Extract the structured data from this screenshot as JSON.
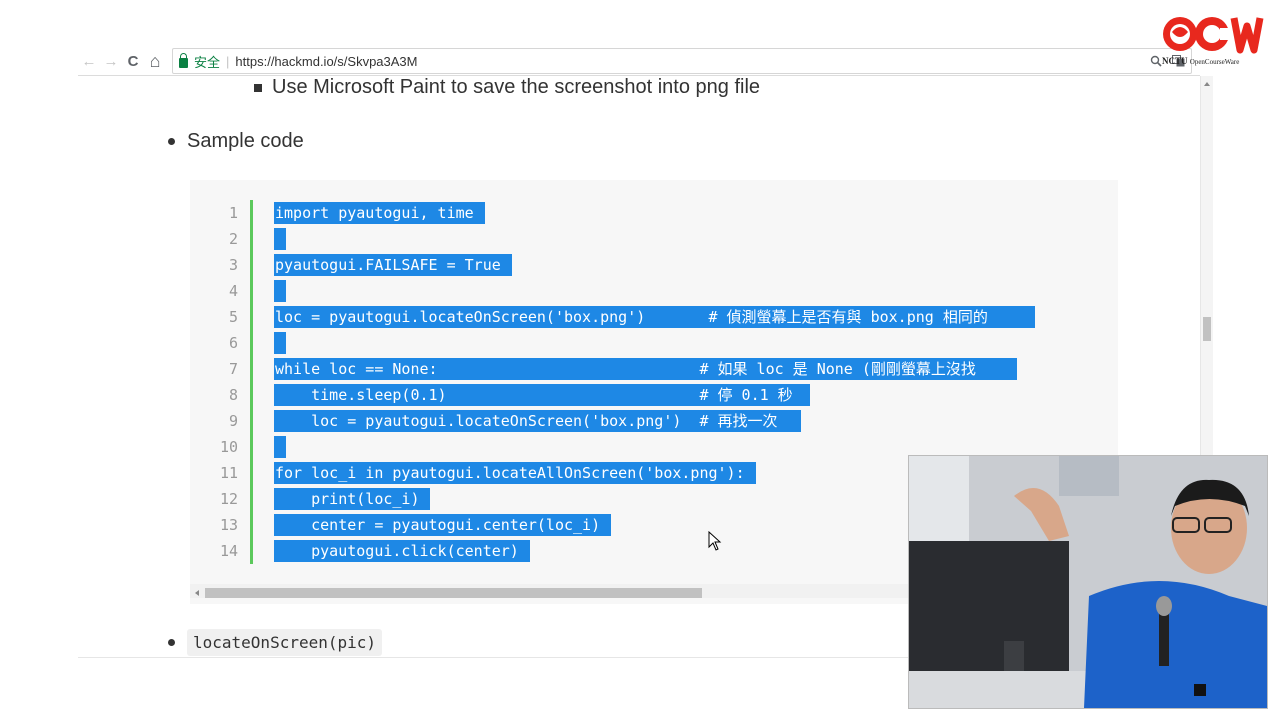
{
  "browser": {
    "back": "←",
    "forward": "→",
    "reload": "C",
    "home": "⌂",
    "secure_label": "安全",
    "url": "https://hackmd.io/s/Skvpa3A3M",
    "zoom_icon": "magnifier-icon",
    "translate_icon": "translate-icon"
  },
  "logo": {
    "nctu_text": "NCTU",
    "ocw_text": "OpenCourseWare",
    "big_text": "OCW"
  },
  "content": {
    "sub_bullet": "Use Microsoft Paint to save the screenshot into png file",
    "bullet_sample": "Sample code",
    "bullet_locate": "locateOnScreen(pic)"
  },
  "code": {
    "lines": [
      {
        "n": "1",
        "text": "import pyautogui, time"
      },
      {
        "n": "2",
        "text": ""
      },
      {
        "n": "3",
        "text": "pyautogui.FAILSAFE = True"
      },
      {
        "n": "4",
        "text": ""
      },
      {
        "n": "5",
        "text": "loc = pyautogui.locateOnScreen('box.png')       # 偵測螢幕上是否有與 box.png 相同的"
      },
      {
        "n": "6",
        "text": ""
      },
      {
        "n": "7",
        "text": "while loc == None:                             # 如果 loc 是 None (剛剛螢幕上沒找"
      },
      {
        "n": "8",
        "text": "    time.sleep(0.1)                            # 停 0.1 秒"
      },
      {
        "n": "9",
        "text": "    loc = pyautogui.locateOnScreen('box.png')  # 再找一次"
      },
      {
        "n": "10",
        "text": ""
      },
      {
        "n": "11",
        "text": "for loc_i in pyautogui.locateAllOnScreen('box.png'):"
      },
      {
        "n": "12",
        "text": "    print(loc_i)"
      },
      {
        "n": "13",
        "text": "    center = pyautogui.center(loc_i)"
      },
      {
        "n": "14",
        "text": "    pyautogui.click(center)"
      }
    ]
  },
  "colors": {
    "selection": "#1e88e5",
    "gutter_bar": "#5cc95c",
    "secure_green": "#0b8043",
    "logo_red": "#e8281e"
  }
}
